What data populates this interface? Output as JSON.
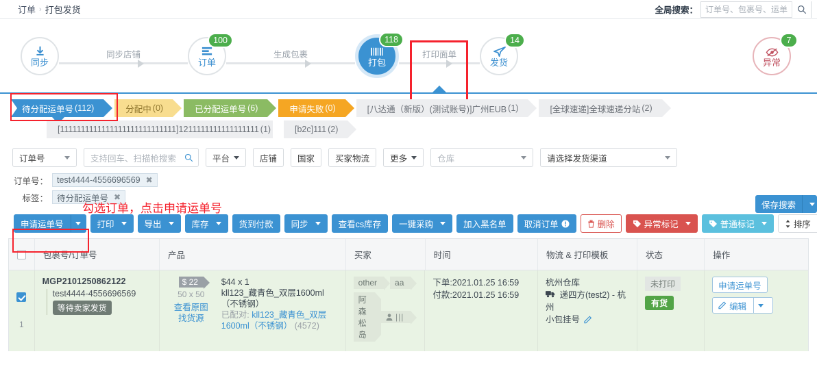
{
  "breadcrumb": {
    "root": "订单",
    "sep": "›",
    "current": "打包发货"
  },
  "global_search": {
    "label": "全局搜索：",
    "placeholder": "订单号、包裹号、运单号",
    "value": "",
    "icon": "search-icon"
  },
  "stepper": {
    "steps": [
      {
        "key": "sync",
        "name": "同步",
        "icon": "download-icon",
        "badge": "",
        "state": "normal"
      },
      {
        "key": "order",
        "name": "订单",
        "icon": "list-icon",
        "badge": "100",
        "state": "normal"
      },
      {
        "key": "pack",
        "name": "打包",
        "icon": "barcode-icon",
        "badge": "118",
        "state": "active"
      },
      {
        "key": "ship",
        "name": "发货",
        "icon": "send-icon",
        "badge": "14",
        "state": "normal"
      },
      {
        "key": "abnormal",
        "name": "异常",
        "icon": "eye-off-icon",
        "badge": "7",
        "state": "error"
      }
    ],
    "links": [
      "同步店铺",
      "生成包裹",
      "打印面单"
    ]
  },
  "tabs": {
    "row1": [
      {
        "label": "待分配运单号",
        "count": "(112)",
        "color": "blue",
        "active": true
      },
      {
        "label": "分配中",
        "count": "(0)",
        "color": "yellow",
        "active": false
      },
      {
        "label": "已分配运单号",
        "count": "(6)",
        "color": "green",
        "active": false
      },
      {
        "label": "申请失败",
        "count": "(0)",
        "color": "orange",
        "active": false
      },
      {
        "label": "[八达通（新版）(测试账号)]广州EUB",
        "count": "(1)",
        "color": "gray",
        "active": false
      },
      {
        "label": "[全球速递]全球速递分站",
        "count": "(2)",
        "color": "gray",
        "active": false
      }
    ],
    "row2": [
      {
        "label": "[1111111111111111111111111111]1211111111111111111",
        "count": "(1)",
        "color": "gray",
        "active": false
      },
      {
        "label": "[b2c]111",
        "count": "(2)",
        "color": "gray",
        "active": false
      }
    ]
  },
  "filters": {
    "field_select": "订单号",
    "search_placeholder": "支持回车、扫描枪搜索",
    "search_value": "",
    "search_icon": "search-icon",
    "platform": "平台",
    "shop": "店铺",
    "country": "国家",
    "buyer_logistics": "买家物流",
    "more": "更多",
    "warehouse_placeholder": "仓库",
    "channel_placeholder": "请选择发货渠道"
  },
  "chips": {
    "order_label": "订单号：",
    "order_value": "test4444-4556696569",
    "tag_label": "标签：",
    "tag_value": "待分配运单号",
    "close_icon": "close-icon"
  },
  "annotation": "勾选订单，点击申请运单号",
  "save_search": {
    "label": "保存搜索",
    "caret_icon": "chevron-down-icon"
  },
  "toolbar": [
    {
      "label": "申请运单号",
      "style": "primary",
      "split": true,
      "icon": ""
    },
    {
      "label": "打印",
      "style": "primary",
      "split": false,
      "caret": true
    },
    {
      "label": "导出",
      "style": "primary",
      "split": false,
      "caret": true
    },
    {
      "label": "库存",
      "style": "primary",
      "split": false,
      "caret": true
    },
    {
      "label": "货到付款",
      "style": "primary",
      "split": false,
      "caret": false
    },
    {
      "label": "同步",
      "style": "primary",
      "split": false,
      "caret": true
    },
    {
      "label": "查看cs库存",
      "style": "primary",
      "split": false,
      "caret": false
    },
    {
      "label": "一键采购",
      "style": "primary",
      "split": false,
      "caret": true
    },
    {
      "label": "加入黑名单",
      "style": "primary",
      "split": false,
      "caret": false
    },
    {
      "label": "取消订单",
      "style": "primary",
      "split": false,
      "caret": false,
      "icon": "info-icon"
    },
    {
      "label": "删除",
      "style": "danger-o",
      "split": false,
      "caret": false,
      "icon": "trash-icon"
    },
    {
      "label": "异常标记",
      "style": "danger",
      "split": false,
      "caret": true,
      "icon": "tag-icon"
    },
    {
      "label": "普通标记",
      "style": "cyan",
      "split": false,
      "caret": true,
      "icon": "tag-icon"
    },
    {
      "label": "排序",
      "style": "white",
      "split": false,
      "caret": true,
      "icon": "sort-icon"
    }
  ],
  "table": {
    "headers": [
      "",
      "包裹号/订单号",
      "产品",
      "买家",
      "时间",
      "物流 & 打印模板",
      "状态",
      "操作"
    ],
    "rows": [
      {
        "checked": true,
        "index": "1",
        "package_no": "MGP2101250862122",
        "order_no": "test4444-4556696569",
        "order_status_tag": "等待卖家发货",
        "product": {
          "price_tag": "$ 22",
          "image_placeholder": "50 x 50",
          "view_image": "查看原图",
          "find_source": "找货源",
          "qty_line": "$44 x 1",
          "name": "kll123_藏青色_双层1600ml（不锈钢）",
          "matched_prefix": "已配对: ",
          "matched_name": "kll123_藏青色_双层1600ml（不锈钢）",
          "matched_code": "(4572)"
        },
        "buyer": {
          "tag1": "other",
          "tag2": "aa",
          "country": "阿森松岛",
          "person_icon": "person-icon",
          "flag_icon": "flag-icon"
        },
        "time": {
          "order": "下单:2021.01.25 16:59",
          "pay": "付款:2021.01.25 16:59"
        },
        "logistics": {
          "warehouse": "杭州仓库",
          "truck_icon": "truck-icon",
          "channel": "递四方(test2) - 杭州",
          "template": "小包挂号",
          "edit_icon": "edit-icon"
        },
        "status": {
          "print": "未打印",
          "stock": "有货"
        },
        "actions": {
          "apply": "申请运单号",
          "edit": "编辑",
          "edit_icon": "edit-icon",
          "caret_icon": "chevron-down-icon"
        }
      }
    ]
  },
  "colors": {
    "primary": "#3b92d2",
    "green": "#52a447",
    "danger": "#d9534f",
    "cyan": "#5bc0de",
    "highlight": "#f5222d"
  }
}
